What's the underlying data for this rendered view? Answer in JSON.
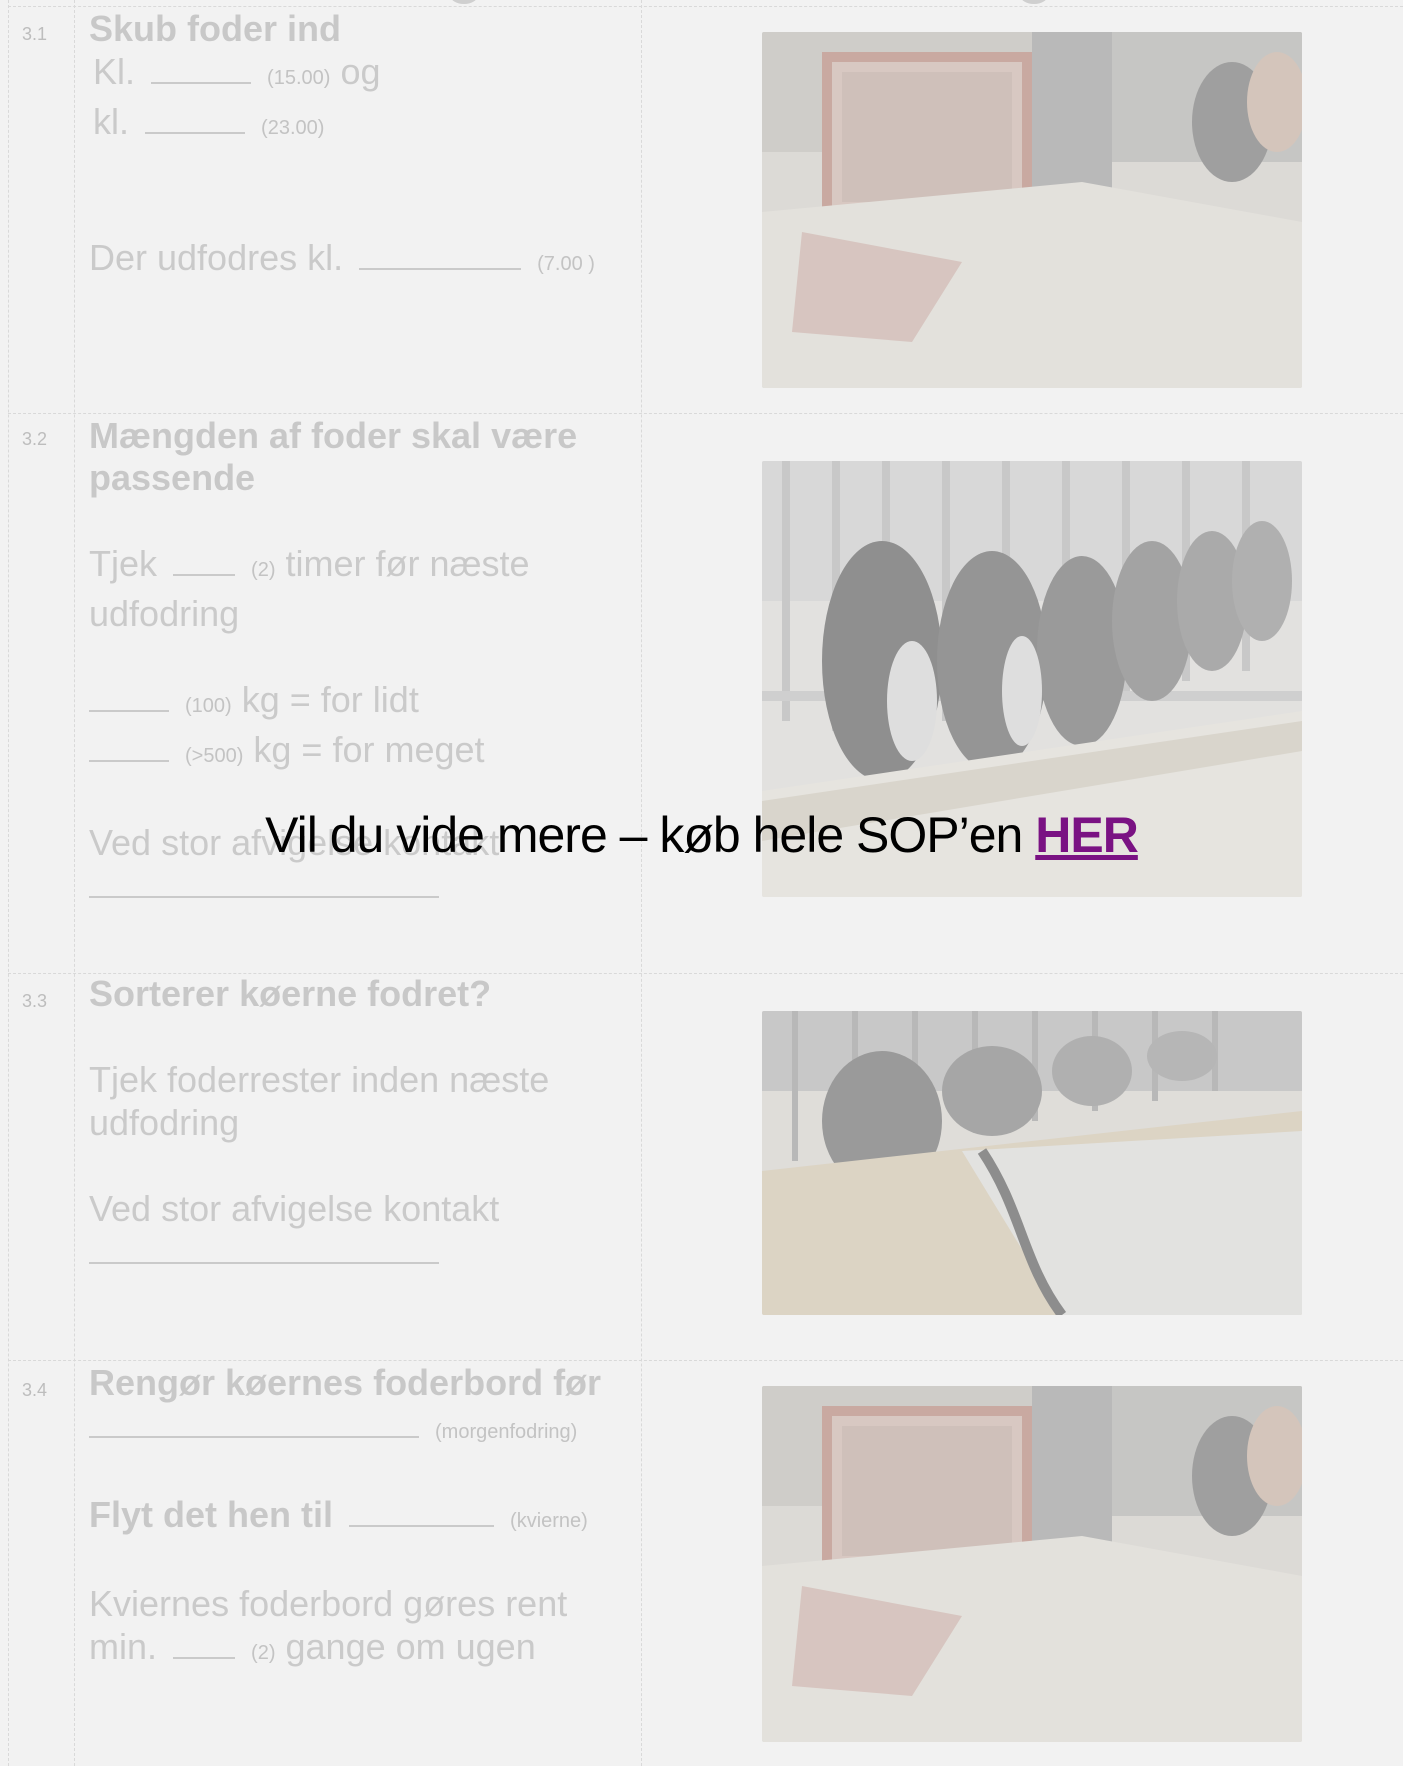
{
  "items": [
    {
      "num": "3.1",
      "title": "Skub foder ind",
      "line1_prefix": "Kl.",
      "line1_hint": "(15.00)",
      "line1_suffix": "og",
      "line2_prefix": "kl.",
      "line2_hint": "(23.00)",
      "line3_prefix": "Der udfodres kl.",
      "line3_hint": "(7.00 )"
    },
    {
      "num": "3.2",
      "title": "Mængden af foder skal være passende",
      "check_prefix": "Tjek",
      "check_hint": "(2)",
      "check_suffix": "timer før næste udfodring",
      "low_hint": "(100)",
      "low_text": "kg = for lidt",
      "high_hint": "(>500)",
      "high_text": "kg = for meget",
      "contact_text": "Ved stor afvigelse kontakt"
    },
    {
      "num": "3.3",
      "title": "Sorterer køerne fodret?",
      "check_text": "Tjek foderrester inden næste udfodring",
      "contact_text": "Ved stor afvigelse kontakt"
    },
    {
      "num": "3.4",
      "title": "Rengør køernes foderbord før",
      "title_hint": "(morgenfodring)",
      "move_title": "Flyt det hen til",
      "move_hint": "(kvierne)",
      "clean_text_1": "Kviernes foderbord gøres rent",
      "clean_prefix": "min.",
      "clean_hint": "(2)",
      "clean_suffix": "gange om ugen"
    }
  ],
  "overlay": {
    "message": "Vil du vide mere – køb hele SOP’en",
    "link_label": "HER",
    "link_color": "#7a1283"
  },
  "photos": [
    {
      "subject": "feed-pusher-tractor-cows"
    },
    {
      "subject": "cows-eating-at-feed-fence"
    },
    {
      "subject": "feed-alley-with-cows"
    },
    {
      "subject": "feed-pusher-tractor-cows"
    }
  ]
}
